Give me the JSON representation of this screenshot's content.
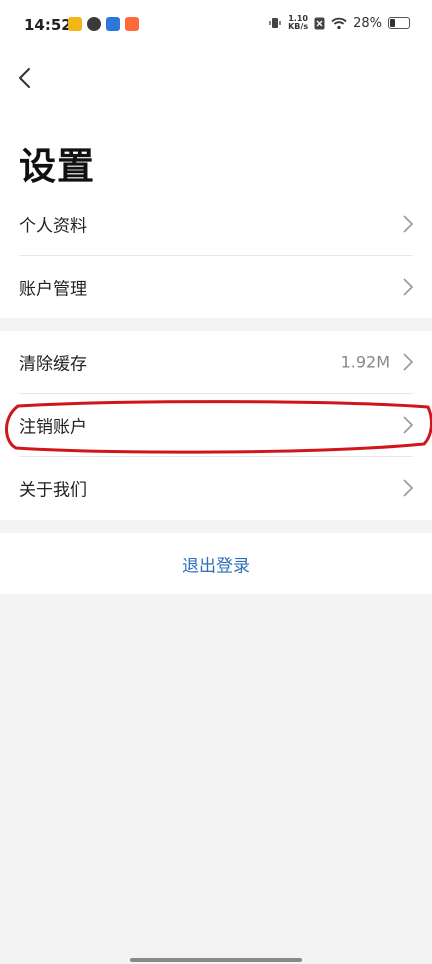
{
  "status_bar": {
    "time": "14:52",
    "net_speed_top": "1.10",
    "net_speed_bottom": "KB/s",
    "battery_percent": "28%",
    "battery_level": 0.28
  },
  "page": {
    "title": "设置"
  },
  "groups": [
    {
      "items": [
        {
          "label": "个人资料",
          "value": ""
        },
        {
          "label": "账户管理",
          "value": ""
        }
      ]
    },
    {
      "items": [
        {
          "label": "清除缓存",
          "value": "1.92M"
        },
        {
          "label": "注销账户",
          "value": ""
        },
        {
          "label": "关于我们",
          "value": ""
        }
      ]
    }
  ],
  "logout": {
    "label": "退出登录"
  },
  "colors": {
    "link": "#2e6fb8",
    "annotation": "#d0161b",
    "background": "#f3f3f3"
  },
  "icons": {
    "back": "back-arrow-icon",
    "chevron": "chevron-right-icon"
  }
}
